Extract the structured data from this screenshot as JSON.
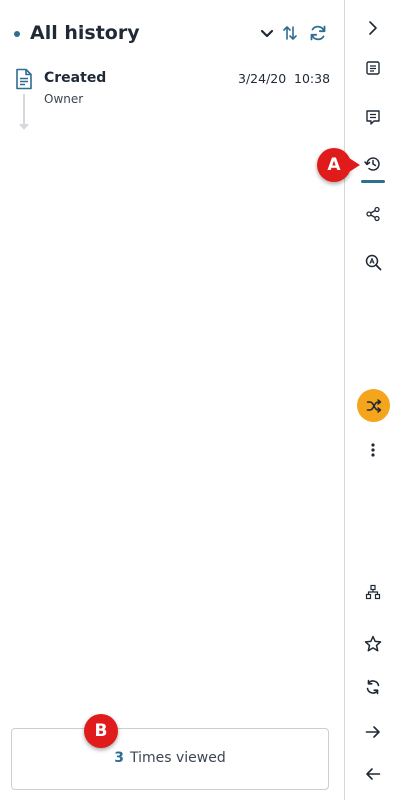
{
  "header": {
    "title": "All history",
    "icons": [
      "chevron-down-icon",
      "sort-icon",
      "refresh-icon"
    ]
  },
  "history": [
    {
      "title": "Created",
      "subtitle": "Owner",
      "date": "3/24/20",
      "time": "10:38",
      "icon": "document-icon"
    }
  ],
  "views": {
    "count": "3",
    "label": "Times viewed"
  },
  "rail": {
    "icons": [
      "chevron-right-icon",
      "details-icon",
      "comments-icon",
      "history-icon",
      "share-icon",
      "search-ai-icon",
      "shuffle-icon",
      "more-icon",
      "hierarchy-icon",
      "star-icon",
      "sync-icon",
      "arrow-right-icon",
      "arrow-left-icon"
    ],
    "active": "history-icon"
  },
  "callouts": {
    "a": "A",
    "b": "B"
  },
  "colors": {
    "accent": "#2f6d92",
    "orange": "#f4a51c",
    "callout": "#e01b1b",
    "text": "#1f2a36"
  }
}
